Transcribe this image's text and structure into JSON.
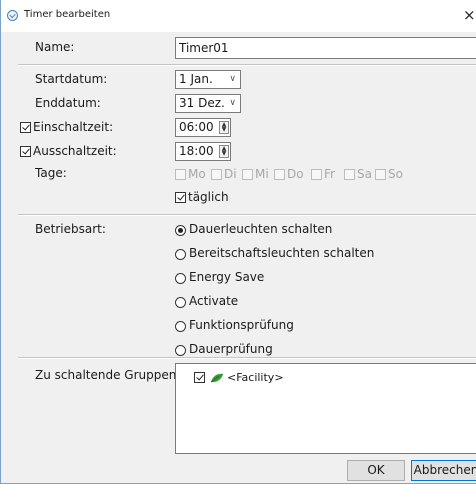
{
  "window": {
    "title": "Timer bearbeiten",
    "close_glyph": "×"
  },
  "form": {
    "name_label": "Name:",
    "name_value": "Timer01",
    "start_label": "Startdatum:",
    "start_value": "1 Jan.",
    "end_label": "Enddatum:",
    "end_value": "31 Dez.",
    "on_time_label": "Einschaltzeit:",
    "on_time_value": "06:00",
    "on_time_checked": true,
    "off_time_label": "Ausschaltzeit:",
    "off_time_value": "18:00",
    "off_time_checked": true,
    "days_label": "Tage:",
    "days": [
      "Mo",
      "Di",
      "Mi",
      "Do",
      "Fr",
      "Sa",
      "So"
    ],
    "daily_label": "täglich",
    "daily_checked": true,
    "mode_label": "Betriebsart:",
    "modes": [
      "Dauerleuchten schalten",
      "Bereitschaftsleuchten schalten",
      "Energy Save",
      "Activate",
      "Funktionsprüfung",
      "Dauerprüfung"
    ],
    "selected_mode": "Dauerleuchten schalten",
    "groups_label": "Zu schaltende Gruppen:",
    "groups": [
      {
        "label": "<Facility>",
        "checked": true,
        "icon": "leaf-icon"
      }
    ]
  },
  "buttons": {
    "ok": "OK",
    "cancel": "Abbrechen"
  },
  "colors": {
    "dialog_bg": "#f0f0f0",
    "default_button_border": "#0078d7",
    "group_icon": "#3a9a3a"
  }
}
